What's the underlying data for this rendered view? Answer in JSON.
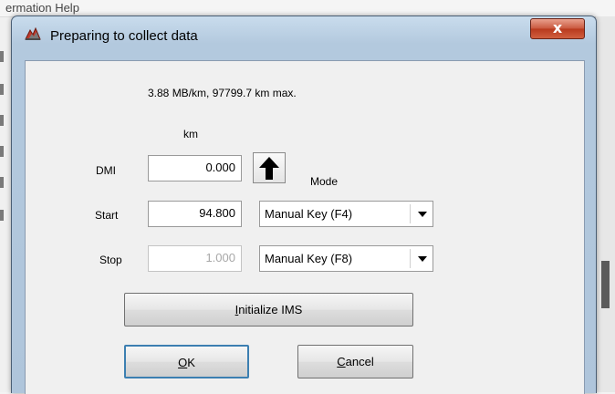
{
  "background": {
    "menu_text": "ermation   Help"
  },
  "dialog": {
    "title": "Preparing to collect data",
    "close_symbol": "x",
    "info_line": "3.88 MB/km,  97799.7 km max.",
    "unit_header": "km",
    "mode_header": "Mode",
    "dmi": {
      "label": "DMI",
      "value": "0.000"
    },
    "start": {
      "label": "Start",
      "value": "94.800",
      "mode": "Manual Key (F4)"
    },
    "stop": {
      "label": "Stop",
      "value": "1.000",
      "mode": "Manual Key (F8)"
    },
    "initialize_button": {
      "prefix": "",
      "underline": "I",
      "rest": "nitialize IMS"
    },
    "ok_button": {
      "underline": "O",
      "rest": "K"
    },
    "cancel_button": {
      "underline": "C",
      "rest": "ancel"
    }
  }
}
